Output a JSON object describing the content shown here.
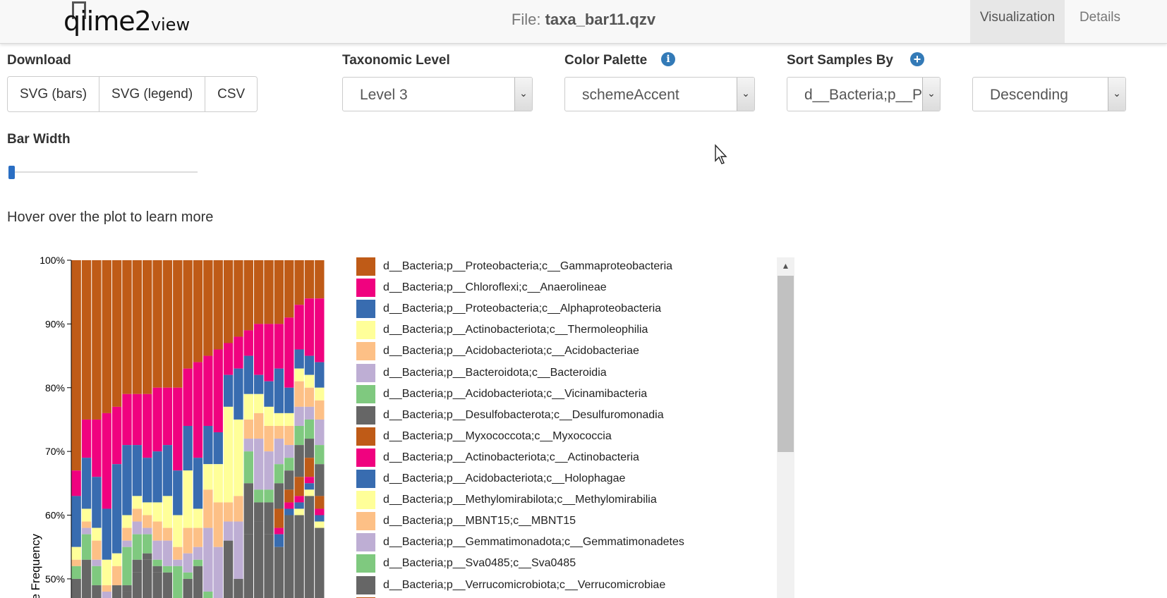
{
  "navbar": {
    "logo_text": "qiime2",
    "logo_suffix": "view",
    "file_prefix": "File: ",
    "file_name": "taxa_bar11.qzv",
    "tabs": [
      {
        "label": "Visualization",
        "active": true
      },
      {
        "label": "Details",
        "active": false
      }
    ]
  },
  "controls": {
    "download_label": "Download",
    "download_buttons": [
      "SVG (bars)",
      "SVG (legend)",
      "CSV"
    ],
    "taxonomic_level_label": "Taxonomic Level",
    "taxonomic_level_value": "Level 3",
    "color_palette_label": "Color Palette",
    "color_palette_value": "schemeAccent",
    "sort_label": "Sort Samples By",
    "sort_value": "d__Bacteria;p__Pr",
    "sort_order_value": "Descending",
    "bar_width_label": "Bar Width",
    "bar_width_level": 0.0,
    "hover_hint": "Hover over the plot to learn more"
  },
  "colors": {
    "accent": "#337ab7",
    "palette": [
      "#bf5b17",
      "#f0027f",
      "#386cb0",
      "#ffff99",
      "#fdc086",
      "#beaed4",
      "#7fc97f",
      "#666666"
    ]
  },
  "legend": [
    {
      "label": "d__Bacteria;p__Proteobacteria;c__Gammaproteobacteria",
      "color": "#bf5b17"
    },
    {
      "label": "d__Bacteria;p__Chloroflexi;c__Anaerolineae",
      "color": "#f0027f"
    },
    {
      "label": "d__Bacteria;p__Proteobacteria;c__Alphaproteobacteria",
      "color": "#386cb0"
    },
    {
      "label": "d__Bacteria;p__Actinobacteriota;c__Thermoleophilia",
      "color": "#ffff99"
    },
    {
      "label": "d__Bacteria;p__Acidobacteriota;c__Acidobacteriae",
      "color": "#fdc086"
    },
    {
      "label": "d__Bacteria;p__Bacteroidota;c__Bacteroidia",
      "color": "#beaed4"
    },
    {
      "label": "d__Bacteria;p__Acidobacteriota;c__Vicinamibacteria",
      "color": "#7fc97f"
    },
    {
      "label": "d__Bacteria;p__Desulfobacterota;c__Desulfuromonadia",
      "color": "#666666"
    },
    {
      "label": "d__Bacteria;p__Myxococcota;c__Myxococcia",
      "color": "#bf5b17"
    },
    {
      "label": "d__Bacteria;p__Actinobacteriota;c__Actinobacteria",
      "color": "#f0027f"
    },
    {
      "label": "d__Bacteria;p__Acidobacteriota;c__Holophagae",
      "color": "#386cb0"
    },
    {
      "label": "d__Bacteria;p__Methylomirabilota;c__Methylomirabilia",
      "color": "#ffff99"
    },
    {
      "label": "d__Bacteria;p__MBNT15;c__MBNT15",
      "color": "#fdc086"
    },
    {
      "label": "d__Bacteria;p__Gemmatimonadota;c__Gemmatimonadetes",
      "color": "#beaed4"
    },
    {
      "label": "d__Bacteria;p__Sva0485;c__Sva0485",
      "color": "#7fc97f"
    },
    {
      "label": "d__Bacteria;p__Verrucomicrobiota;c__Verrucomicrobiae",
      "color": "#666666"
    },
    {
      "label": "",
      "color": "#bf5b17"
    }
  ],
  "chart_data": {
    "type": "bar",
    "stacked": true,
    "ylabel": "ve Frequency",
    "ylim": [
      0.47,
      1.0
    ],
    "yticks": [
      "100%",
      "90%",
      "80%",
      "70%",
      "60%",
      "50%"
    ],
    "ytick_values": [
      1.0,
      0.9,
      0.8,
      0.7,
      0.6,
      0.5
    ],
    "series_colors": [
      "#bf5b17",
      "#f0027f",
      "#386cb0",
      "#ffff99",
      "#fdc086",
      "#beaed4",
      "#7fc97f",
      "#666666",
      "#bf5b17",
      "#f0027f",
      "#386cb0",
      "#ffff99"
    ],
    "samples": [
      [
        0.33,
        0.04,
        0.08,
        0.02,
        0.01,
        0.0,
        0.02,
        0.0,
        0.0,
        0.0,
        0.0,
        0.0
      ],
      [
        0.25,
        0.06,
        0.08,
        0.02,
        0.01,
        0.01,
        0.04,
        0.0,
        0.0,
        0.0,
        0.0,
        0.0
      ],
      [
        0.25,
        0.09,
        0.08,
        0.02,
        0.03,
        0.01,
        0.03,
        0.0,
        0.0,
        0.0,
        0.0,
        0.0
      ],
      [
        0.24,
        0.15,
        0.08,
        0.04,
        0.01,
        0.01,
        0.0,
        0.0,
        0.0,
        0.0,
        0.0,
        0.0
      ],
      [
        0.23,
        0.09,
        0.14,
        0.02,
        0.03,
        0.0,
        0.0,
        0.0,
        0.0,
        0.0,
        0.0,
        0.0
      ],
      [
        0.21,
        0.08,
        0.11,
        0.02,
        0.02,
        0.01,
        0.06,
        0.01,
        0.0,
        0.0,
        0.0,
        0.0
      ],
      [
        0.21,
        0.08,
        0.08,
        0.02,
        0.02,
        0.02,
        0.04,
        0.02,
        0.0,
        0.0,
        0.0,
        0.0
      ],
      [
        0.21,
        0.1,
        0.07,
        0.02,
        0.02,
        0.01,
        0.03,
        0.01,
        0.0,
        0.0,
        0.0,
        0.0
      ],
      [
        0.2,
        0.1,
        0.08,
        0.03,
        0.03,
        0.03,
        0.01,
        0.01,
        0.0,
        0.0,
        0.0,
        0.0
      ],
      [
        0.2,
        0.09,
        0.08,
        0.05,
        0.02,
        0.04,
        0.01,
        0.0,
        0.0,
        0.0,
        0.0,
        0.0
      ],
      [
        0.2,
        0.13,
        0.07,
        0.05,
        0.02,
        0.01,
        0.08,
        0.01,
        0.0,
        0.0,
        0.0,
        0.0
      ],
      [
        0.17,
        0.09,
        0.07,
        0.09,
        0.04,
        0.03,
        0.01,
        0.0,
        0.0,
        0.0,
        0.0,
        0.0
      ],
      [
        0.16,
        0.15,
        0.08,
        0.03,
        0.03,
        0.02,
        0.01,
        0.0,
        0.0,
        0.0,
        0.0,
        0.0
      ],
      [
        0.15,
        0.11,
        0.06,
        0.04,
        0.06,
        0.1,
        0.02,
        0.0,
        0.0,
        0.0,
        0.0,
        0.0
      ],
      [
        0.14,
        0.13,
        0.05,
        0.06,
        0.07,
        0.09,
        0.02,
        0.0,
        0.0,
        0.0,
        0.0,
        0.0
      ],
      [
        0.13,
        0.05,
        0.05,
        0.15,
        0.03,
        0.03,
        0.0,
        0.0,
        0.0,
        0.0,
        0.0,
        0.0
      ],
      [
        0.12,
        0.05,
        0.08,
        0.12,
        0.04,
        0.09,
        0.0,
        0.0,
        0.0,
        0.0,
        0.0,
        0.0
      ],
      [
        0.11,
        0.04,
        0.06,
        0.04,
        0.03,
        0.02,
        0.05,
        0.08,
        0.0,
        0.0,
        0.0,
        0.0
      ],
      [
        0.1,
        0.08,
        0.03,
        0.03,
        0.04,
        0.08,
        0.02,
        0.03,
        0.0,
        0.0,
        0.0,
        0.0
      ],
      [
        0.1,
        0.09,
        0.04,
        0.03,
        0.04,
        0.06,
        0.02,
        0.05,
        0.0,
        0.0,
        0.0,
        0.0
      ],
      [
        0.1,
        0.07,
        0.07,
        0.02,
        0.02,
        0.04,
        0.03,
        0.04,
        0.03,
        0.01,
        0.02,
        0.0
      ],
      [
        0.09,
        0.11,
        0.04,
        0.02,
        0.03,
        0.02,
        0.02,
        0.03,
        0.02,
        0.01,
        0.01,
        0.0
      ],
      [
        0.07,
        0.07,
        0.03,
        0.02,
        0.04,
        0.03,
        0.03,
        0.05,
        0.03,
        0.01,
        0.01,
        0.01
      ],
      [
        0.06,
        0.09,
        0.03,
        0.02,
        0.03,
        0.02,
        0.03,
        0.03,
        0.03,
        0.01,
        0.01,
        0.01
      ],
      [
        0.06,
        0.1,
        0.04,
        0.02,
        0.03,
        0.04,
        0.03,
        0.05,
        0.02,
        0.01,
        0.01,
        0.01
      ]
    ]
  }
}
